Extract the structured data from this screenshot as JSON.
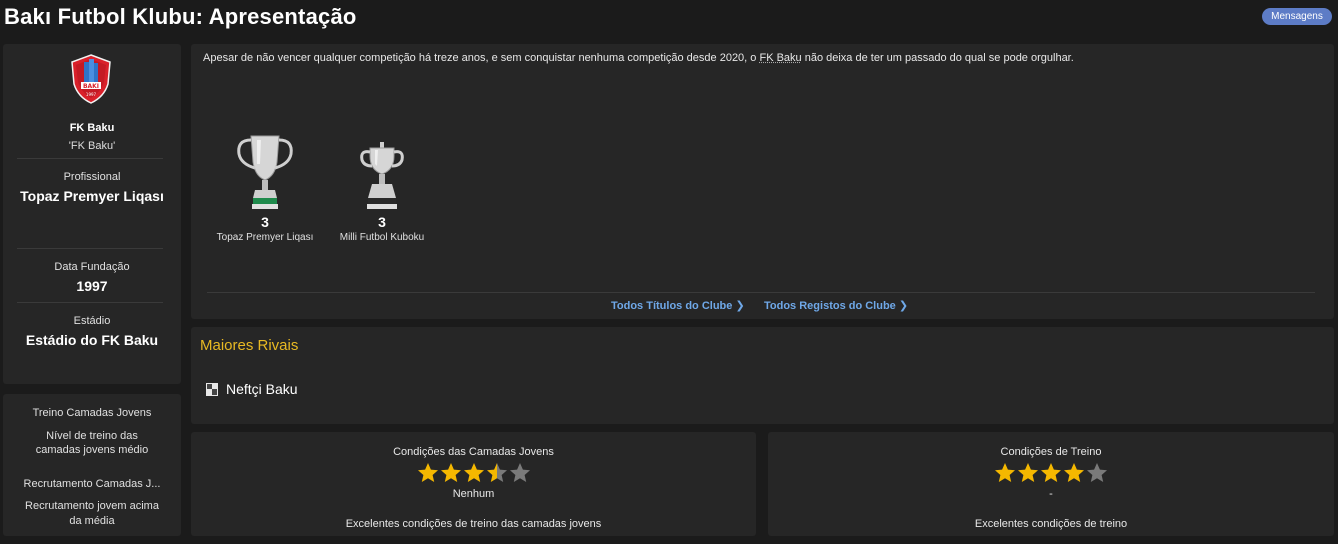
{
  "header": {
    "title": "Bakı Futbol Klubu: Apresentação",
    "messages_button": "Mensagens"
  },
  "club": {
    "short_name": "FK Baku",
    "nickname": "'FK Baku'",
    "status_label": "Profissional",
    "league": "Topaz Premyer Liqası",
    "founded_label": "Data Fundação",
    "founded_year": "1997",
    "stadium_label": "Estádio",
    "stadium": "Estádio do FK Baku",
    "crest_text": "BAKI",
    "crest_year": "1997"
  },
  "training": {
    "youth_training_label": "Treino Camadas Jovens",
    "youth_training_level_1": "Nível de treino das",
    "youth_training_level_2": "camadas jovens médio",
    "youth_recruitment_label": "Recrutamento Camadas J...",
    "youth_recruitment_value_1": "Recrutamento jovem acima",
    "youth_recruitment_value_2": "da média"
  },
  "overview": {
    "intro_before": "Apesar de não vencer qualquer competição há treze anos, e sem conquistar nenhuma competição desde 2020, o ",
    "intro_link": "FK Baku",
    "intro_after": " não deixa de ter um passado do qual se pode orgulhar.",
    "trophies": [
      {
        "count": "3",
        "name": "Topaz Premyer Liqası"
      },
      {
        "count": "3",
        "name": "Milli Futbol Kuboku"
      }
    ],
    "all_titles_link": "Todos Títulos do Clube",
    "all_records_link": "Todos Registos do Clube"
  },
  "rivals": {
    "title": "Maiores Rivais",
    "items": [
      {
        "name": "Neftçi Baku"
      }
    ]
  },
  "facilities": {
    "youth": {
      "title": "Condições das Camadas Jovens",
      "rating": 3.5,
      "max": 5,
      "subtitle": "Nenhum",
      "description": "Excelentes condições de treino das camadas jovens"
    },
    "training": {
      "title": "Condições de Treino",
      "rating": 4,
      "max": 5,
      "subtitle": "-",
      "description": "Excelentes condições de treino"
    }
  },
  "colors": {
    "background": "#1b1b1b",
    "panel": "#262626",
    "accent_gold": "#e8b923",
    "link_blue": "#6fa8e8",
    "star_gold": "#f5b800",
    "star_grey": "#7a7a7a",
    "messages_button": "#5d7cc6"
  }
}
